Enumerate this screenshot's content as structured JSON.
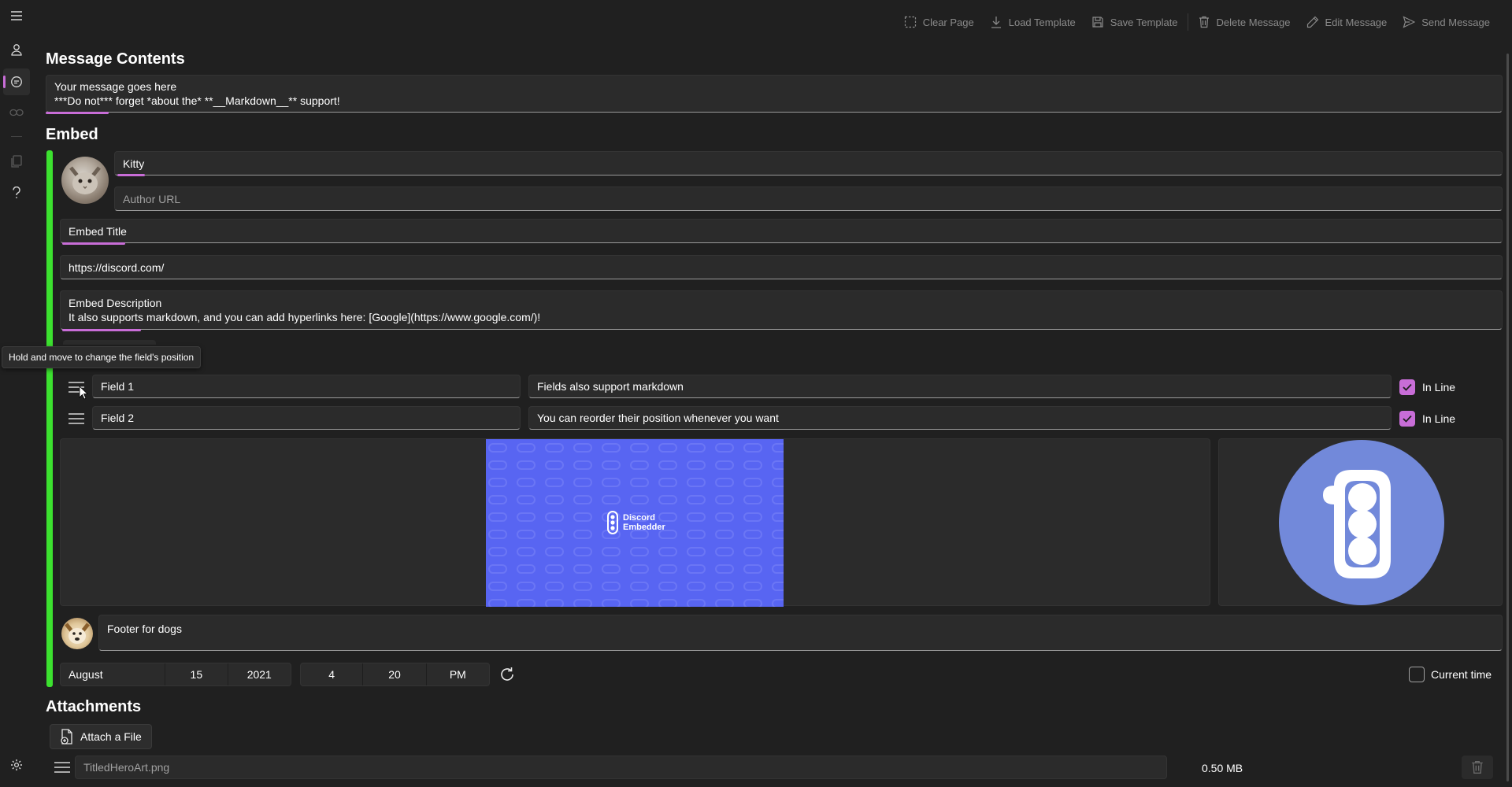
{
  "toolbar": {
    "clear_page": "Clear Page",
    "load_template": "Load Template",
    "save_template": "Save Template",
    "delete_message": "Delete Message",
    "edit_message": "Edit Message",
    "send_message": "Send Message"
  },
  "message": {
    "section_title": "Message Contents",
    "line1": "Your message goes here",
    "line2": "***Do not*** forget *about the* **__Markdown__** support!"
  },
  "embed": {
    "section_title": "Embed",
    "author_name": "Kitty",
    "author_url_placeholder": "Author URL",
    "title": "Embed Title",
    "url": "https://discord.com/",
    "description_line1": "Embed Description",
    "description_line2": "It also supports markdown, and you can add hyperlinks here: [Google](https://www.google.com/)!",
    "side_color": "#3ce12f",
    "fields": [
      {
        "name": "Field 1",
        "value": "Fields also support markdown",
        "inline_label": "In Line",
        "inline": true
      },
      {
        "name": "Field 2",
        "value": "You can reorder their position whenever you want",
        "inline_label": "In Line",
        "inline": true
      }
    ],
    "image_text_line1": "Discord",
    "image_text_line2": "Embedder",
    "footer": "Footer for dogs",
    "timestamp": {
      "month": "August",
      "day": "15",
      "year": "2021",
      "hour": "4",
      "minute": "20",
      "ampm": "PM",
      "current_time_label": "Current time"
    }
  },
  "tooltip": "Hold and move to change the field's position",
  "attachments": {
    "section_title": "Attachments",
    "attach_button": "Attach a File",
    "files": [
      {
        "name": "TitledHeroArt.png",
        "size": "0.50 MB"
      }
    ]
  },
  "colors": {
    "accent": "#c86dd7",
    "image_bg": "#5865f2",
    "thumb_bg": "#7289da"
  }
}
